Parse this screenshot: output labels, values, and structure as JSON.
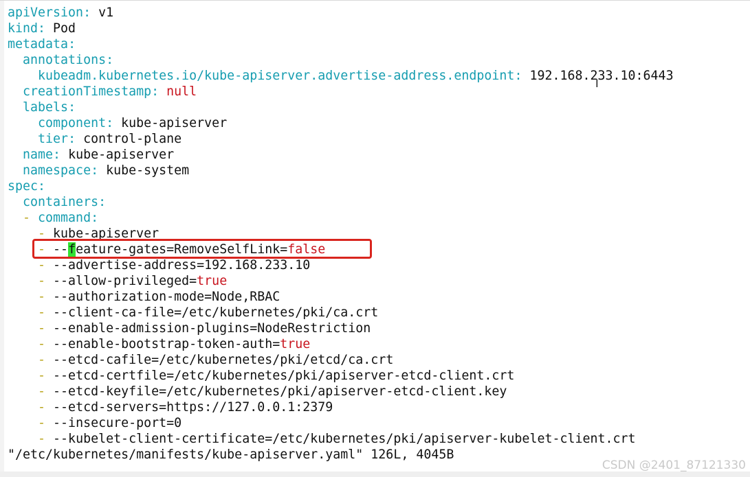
{
  "file": {
    "lines": [
      {
        "indent": "",
        "dash": "",
        "key": "apiVersion",
        "sep": ": ",
        "value": "v1",
        "vclass": "v"
      },
      {
        "indent": "",
        "dash": "",
        "key": "kind",
        "sep": ": ",
        "value": "Pod",
        "vclass": "v"
      },
      {
        "indent": "",
        "dash": "",
        "key": "metadata",
        "sep": ":",
        "value": "",
        "vclass": "v"
      },
      {
        "indent": "  ",
        "dash": "",
        "key": "annotations",
        "sep": ":",
        "value": "",
        "vclass": "v"
      },
      {
        "indent": "    ",
        "dash": "",
        "key": "kubeadm.kubernetes.io/kube-apiserver.advertise-address.endpoint",
        "sep": ": ",
        "value": "192.168.233.10:6443",
        "vclass": "v"
      },
      {
        "indent": "  ",
        "dash": "",
        "key": "creationTimestamp",
        "sep": ": ",
        "value": "null",
        "vclass": "r"
      },
      {
        "indent": "  ",
        "dash": "",
        "key": "labels",
        "sep": ":",
        "value": "",
        "vclass": "v"
      },
      {
        "indent": "    ",
        "dash": "",
        "key": "component",
        "sep": ": ",
        "value": "kube-apiserver",
        "vclass": "v"
      },
      {
        "indent": "    ",
        "dash": "",
        "key": "tier",
        "sep": ": ",
        "value": "control-plane",
        "vclass": "v"
      },
      {
        "indent": "  ",
        "dash": "",
        "key": "name",
        "sep": ": ",
        "value": "kube-apiserver",
        "vclass": "v"
      },
      {
        "indent": "  ",
        "dash": "",
        "key": "namespace",
        "sep": ": ",
        "value": "kube-system",
        "vclass": "v"
      },
      {
        "indent": "",
        "dash": "",
        "key": "spec",
        "sep": ":",
        "value": "",
        "vclass": "v"
      },
      {
        "indent": "  ",
        "dash": "",
        "key": "containers",
        "sep": ":",
        "value": "",
        "vclass": "v"
      },
      {
        "indent": "  ",
        "dash": "- ",
        "key": "command",
        "sep": ":",
        "value": "",
        "vclass": "v"
      },
      {
        "indent": "    ",
        "dash": "- ",
        "key": "",
        "sep": "",
        "value": "kube-apiserver",
        "vclass": "v"
      },
      {
        "indent": "    ",
        "dash": "- ",
        "key": "",
        "sep": "",
        "value": "",
        "vclass": "v",
        "special": true
      },
      {
        "indent": "    ",
        "dash": "- ",
        "key": "",
        "sep": "",
        "value": "--advertise-address=192.168.233.10",
        "vclass": "v"
      },
      {
        "indent": "    ",
        "dash": "- ",
        "key": "",
        "sep": "",
        "value": "--allow-privileged=",
        "vclass": "v",
        "tail": "true"
      },
      {
        "indent": "    ",
        "dash": "- ",
        "key": "",
        "sep": "",
        "value": "--authorization-mode=Node,RBAC",
        "vclass": "v"
      },
      {
        "indent": "    ",
        "dash": "- ",
        "key": "",
        "sep": "",
        "value": "--client-ca-file=/etc/kubernetes/pki/ca.crt",
        "vclass": "v"
      },
      {
        "indent": "    ",
        "dash": "- ",
        "key": "",
        "sep": "",
        "value": "--enable-admission-plugins=NodeRestriction",
        "vclass": "v"
      },
      {
        "indent": "    ",
        "dash": "- ",
        "key": "",
        "sep": "",
        "value": "--enable-bootstrap-token-auth=",
        "vclass": "v",
        "tail": "true"
      },
      {
        "indent": "    ",
        "dash": "- ",
        "key": "",
        "sep": "",
        "value": "--etcd-cafile=/etc/kubernetes/pki/etcd/ca.crt",
        "vclass": "v"
      },
      {
        "indent": "    ",
        "dash": "- ",
        "key": "",
        "sep": "",
        "value": "--etcd-certfile=/etc/kubernetes/pki/apiserver-etcd-client.crt",
        "vclass": "v"
      },
      {
        "indent": "    ",
        "dash": "- ",
        "key": "",
        "sep": "",
        "value": "--etcd-keyfile=/etc/kubernetes/pki/apiserver-etcd-client.key",
        "vclass": "v"
      },
      {
        "indent": "    ",
        "dash": "- ",
        "key": "",
        "sep": "",
        "value": "--etcd-servers=https://127.0.0.1:2379",
        "vclass": "v"
      },
      {
        "indent": "    ",
        "dash": "- ",
        "key": "",
        "sep": "",
        "value": "--insecure-port=0",
        "vclass": "v"
      },
      {
        "indent": "    ",
        "dash": "- ",
        "key": "",
        "sep": "",
        "value": "--kubelet-client-certificate=/etc/kubernetes/pki/apiserver-kubelet-client.crt",
        "vclass": "v"
      }
    ],
    "cursor_line": {
      "prefix": "--",
      "cursor_char": "f",
      "rest": "eature-gates=RemoveSelfLink=",
      "tail": "false"
    }
  },
  "status_line": "\"/etc/kubernetes/manifests/kube-apiserver.yaml\" 126L, 4045B",
  "watermark": "CSDN @2401_87121330",
  "colors": {
    "key": "#169db0",
    "literal": "#c8141e",
    "dash": "#b9a41a",
    "cursor": "#33e233",
    "annotation_box": "#d9251e"
  },
  "icons": {
    "mouse_cursor": "text-cursor-icon"
  }
}
